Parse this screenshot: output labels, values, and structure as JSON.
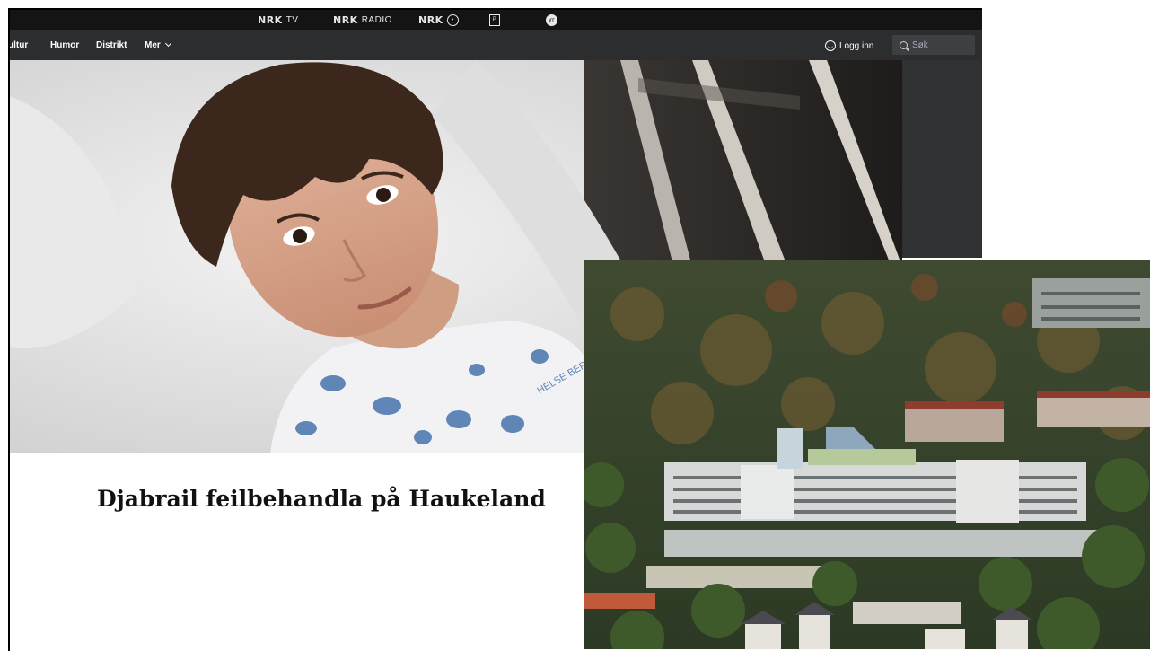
{
  "topbar": {
    "brands": [
      "NRK TV",
      "NRK RADIO",
      "NRK Super",
      "yr"
    ],
    "tv_label": "TV",
    "radio_label": "RADIO"
  },
  "nav": {
    "items": [
      "ultur",
      "Humor",
      "Distrikt",
      "Mer"
    ],
    "login_label": "Logg inn",
    "search_placeholder": "Søk"
  },
  "article": {
    "headline": "Djabrail feilbehandla på Haukeland",
    "photo_gown_text": "HELSE BERGEN"
  },
  "colors": {
    "topbar": "#141414",
    "navbar": "#2b2d2e",
    "headline": "#111111"
  },
  "icons": [
    "nrk-tv-logo",
    "nrk-radio-logo",
    "nrk-super-logo",
    "nrk-p3-icon",
    "yr-icon",
    "user-icon",
    "search-icon",
    "chevron-down-icon"
  ]
}
